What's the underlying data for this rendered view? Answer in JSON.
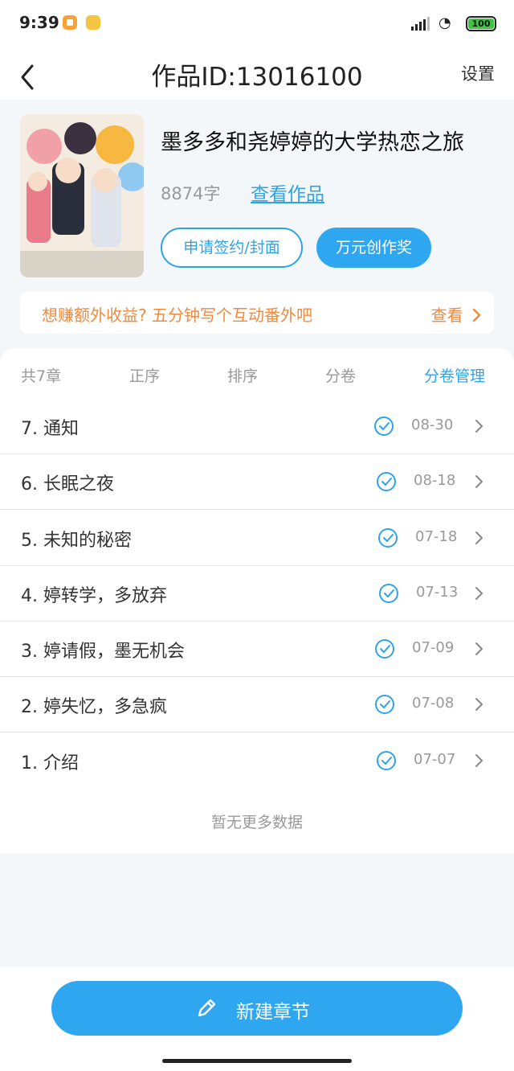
{
  "status_bar": {
    "time": "9:39",
    "battery": "100"
  },
  "nav": {
    "title": "作品ID:13016100",
    "settings_label": "设置"
  },
  "book": {
    "title": "墨多多和尧婷婷的大学热恋之旅",
    "word_count": "8874字",
    "view_label": "查看作品",
    "apply_label": "申请签约/封面",
    "award_label": "万元创作奖"
  },
  "promo": {
    "text": "想赚额外收益? 五分钟写个互动番外吧",
    "more_label": "查看"
  },
  "tabs": {
    "total": "共7章",
    "order": "正序",
    "sort": "排序",
    "volume": "分卷",
    "volume_manage": "分卷管理"
  },
  "chapters": [
    {
      "title": "7. 通知",
      "date": "08-30"
    },
    {
      "title": "6. 长眠之夜",
      "date": "08-18"
    },
    {
      "title": "5. 未知的秘密",
      "date": "07-18"
    },
    {
      "title": "4. 婷转学，多放弃",
      "date": "07-13"
    },
    {
      "title": "3. 婷请假，墨无机会",
      "date": "07-09"
    },
    {
      "title": "2. 婷失忆，多急疯",
      "date": "07-08"
    },
    {
      "title": "1. 介绍",
      "date": "07-07"
    }
  ],
  "no_more_text": "暂无更多数据",
  "new_chapter_label": "新建章节",
  "colors": {
    "accent": "#2ea7f0",
    "promo": "#f08a3e",
    "background": "#f3f7fa"
  }
}
